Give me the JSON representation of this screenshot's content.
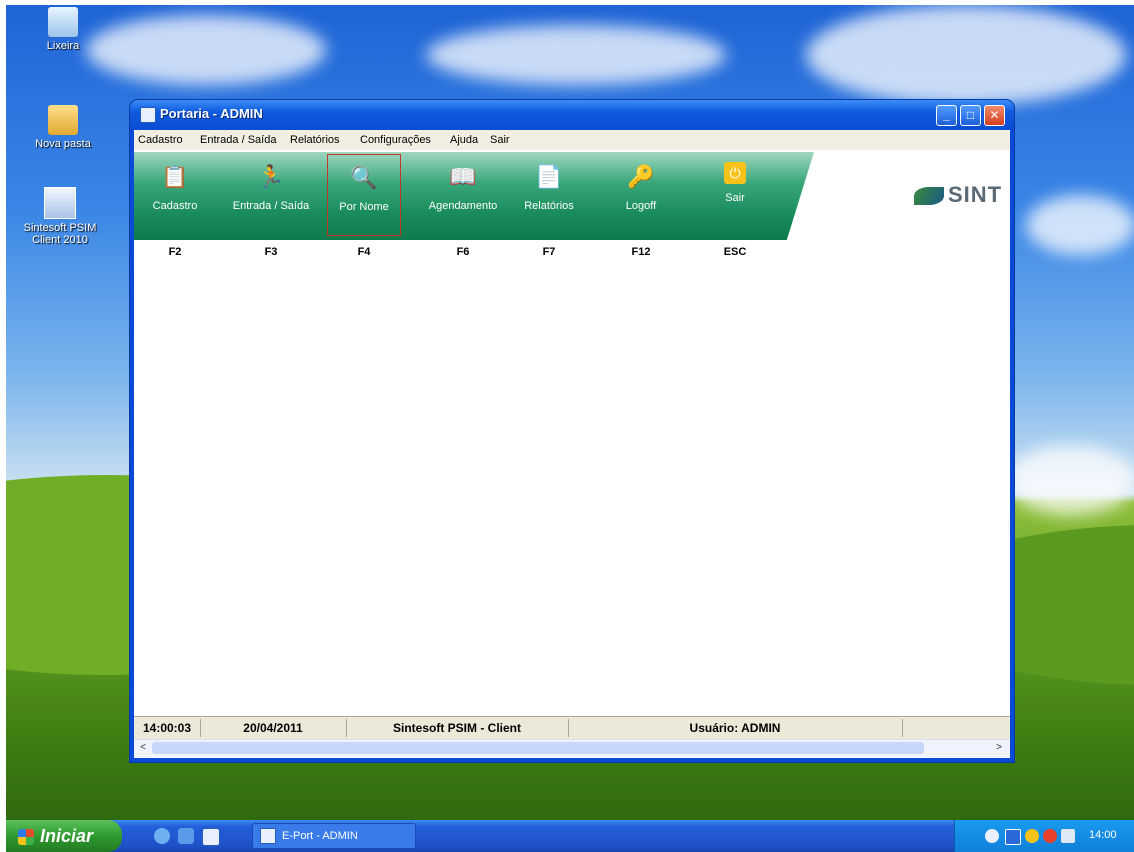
{
  "desktop": {
    "icons": [
      {
        "label": "Lixeira",
        "icon": "recycle-bin-icon"
      },
      {
        "label": "Nova pasta",
        "icon": "folder-icon"
      },
      {
        "label": "Sintesoft PSIM Client 2010",
        "icon": "shortcut-icon"
      }
    ]
  },
  "window": {
    "title": "Portaria - ADMIN",
    "buttons": {
      "minimize": "_",
      "maximize": "□",
      "close": "✕"
    }
  },
  "menu": [
    "Cadastro",
    "Entrada / Saída",
    "Relatórios",
    "Configurações",
    "Ajuda",
    "Sair"
  ],
  "toolbar": [
    {
      "label": "Cadastro",
      "key": "F2",
      "icon": "clipboard-icon"
    },
    {
      "label": "Entrada / Saída",
      "key": "F3",
      "icon": "running-man-icon"
    },
    {
      "label": "Por Nome",
      "key": "F4",
      "icon": "person-search-icon",
      "selected": true
    },
    {
      "label": "Agendamento",
      "key": "F6",
      "icon": "book-icon"
    },
    {
      "label": "Relatórios",
      "key": "F7",
      "icon": "document-icon"
    },
    {
      "label": "Logoff",
      "key": "F12",
      "icon": "keys-icon"
    },
    {
      "label": "Sair",
      "key": "ESC",
      "icon": "exit-icon"
    }
  ],
  "logo": "SINT",
  "status": {
    "time": "14:00:03",
    "date": "20/04/2011",
    "app": "Sintesoft PSIM - Client",
    "user": "Usuário: ADMIN"
  },
  "scroll": {
    "left": "<",
    "right": ">"
  },
  "taskbar": {
    "start": "Iniciar",
    "item": "E-Port - ADMIN",
    "clock": "14:00"
  },
  "colors": {
    "titlebar": "#0a4cd0",
    "toolbar": "#1a8c5c",
    "taskbar": "#245edb",
    "start": "#2f9a2f",
    "selected_border": "#c0392b"
  }
}
